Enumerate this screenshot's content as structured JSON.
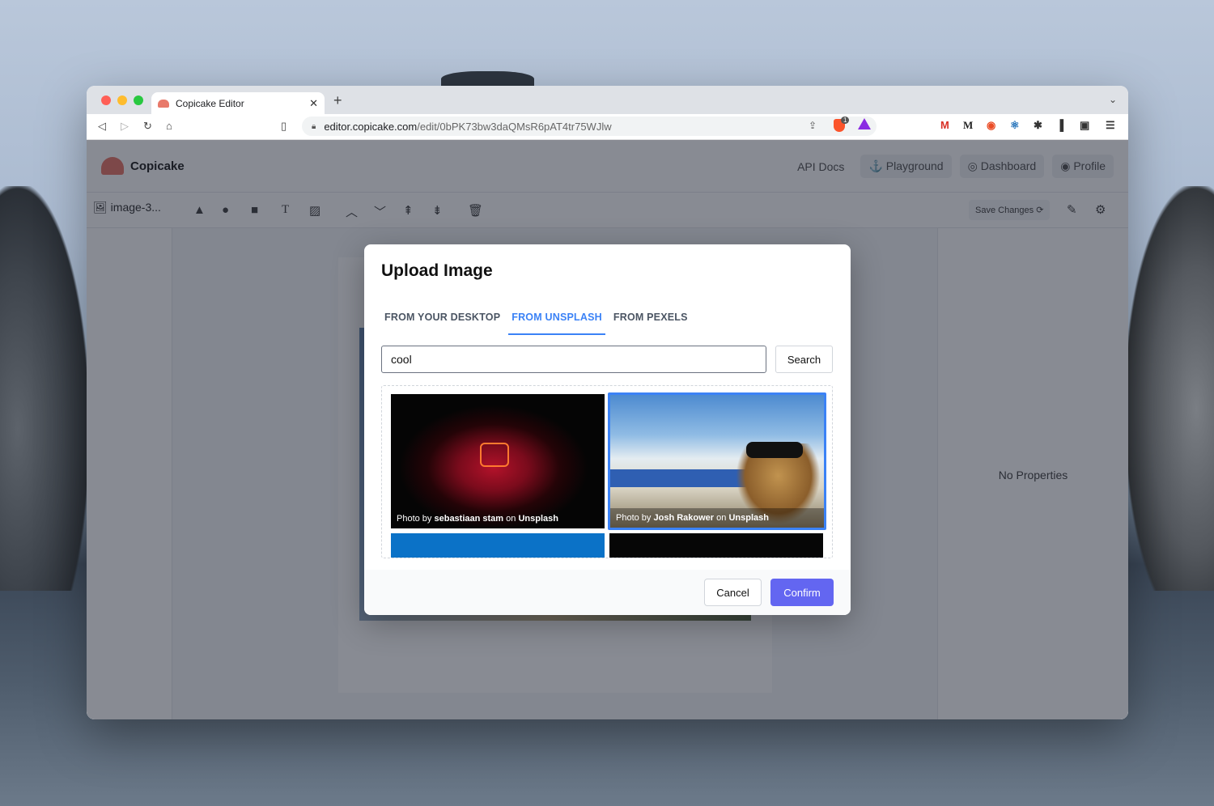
{
  "browser": {
    "tab_title": "Copicake Editor",
    "url_host": "editor.copicake.com",
    "url_path": "/edit/0bPK73bw3daQMsR6pAT4tr75WJlw",
    "shield_count": "1"
  },
  "app": {
    "logo_text": "Copicake",
    "nav": {
      "api_docs": "API Docs",
      "playground": "Playground",
      "dashboard": "Dashboard",
      "profile": "Profile"
    },
    "layer_name": "image-3...",
    "save_changes": "Save Changes",
    "no_properties": "No Properties"
  },
  "modal": {
    "title": "Upload Image",
    "tabs": [
      {
        "label": "FROM YOUR DESKTOP",
        "active": false
      },
      {
        "label": "FROM UNSPLASH",
        "active": true
      },
      {
        "label": "FROM PEXELS",
        "active": false
      }
    ],
    "search": {
      "value": "cool",
      "button": "Search"
    },
    "photos": [
      {
        "prefix": "Photo by ",
        "author": "sebastiaan stam",
        "middle": " on ",
        "source": "Unsplash",
        "selected": false
      },
      {
        "prefix": "Photo by ",
        "author": "Josh Rakower",
        "middle": " on ",
        "source": "Unsplash",
        "selected": true
      }
    ],
    "cancel": "Cancel",
    "confirm": "Confirm"
  },
  "colors": {
    "accent": "#3b82f6",
    "confirm": "#6366f1"
  }
}
